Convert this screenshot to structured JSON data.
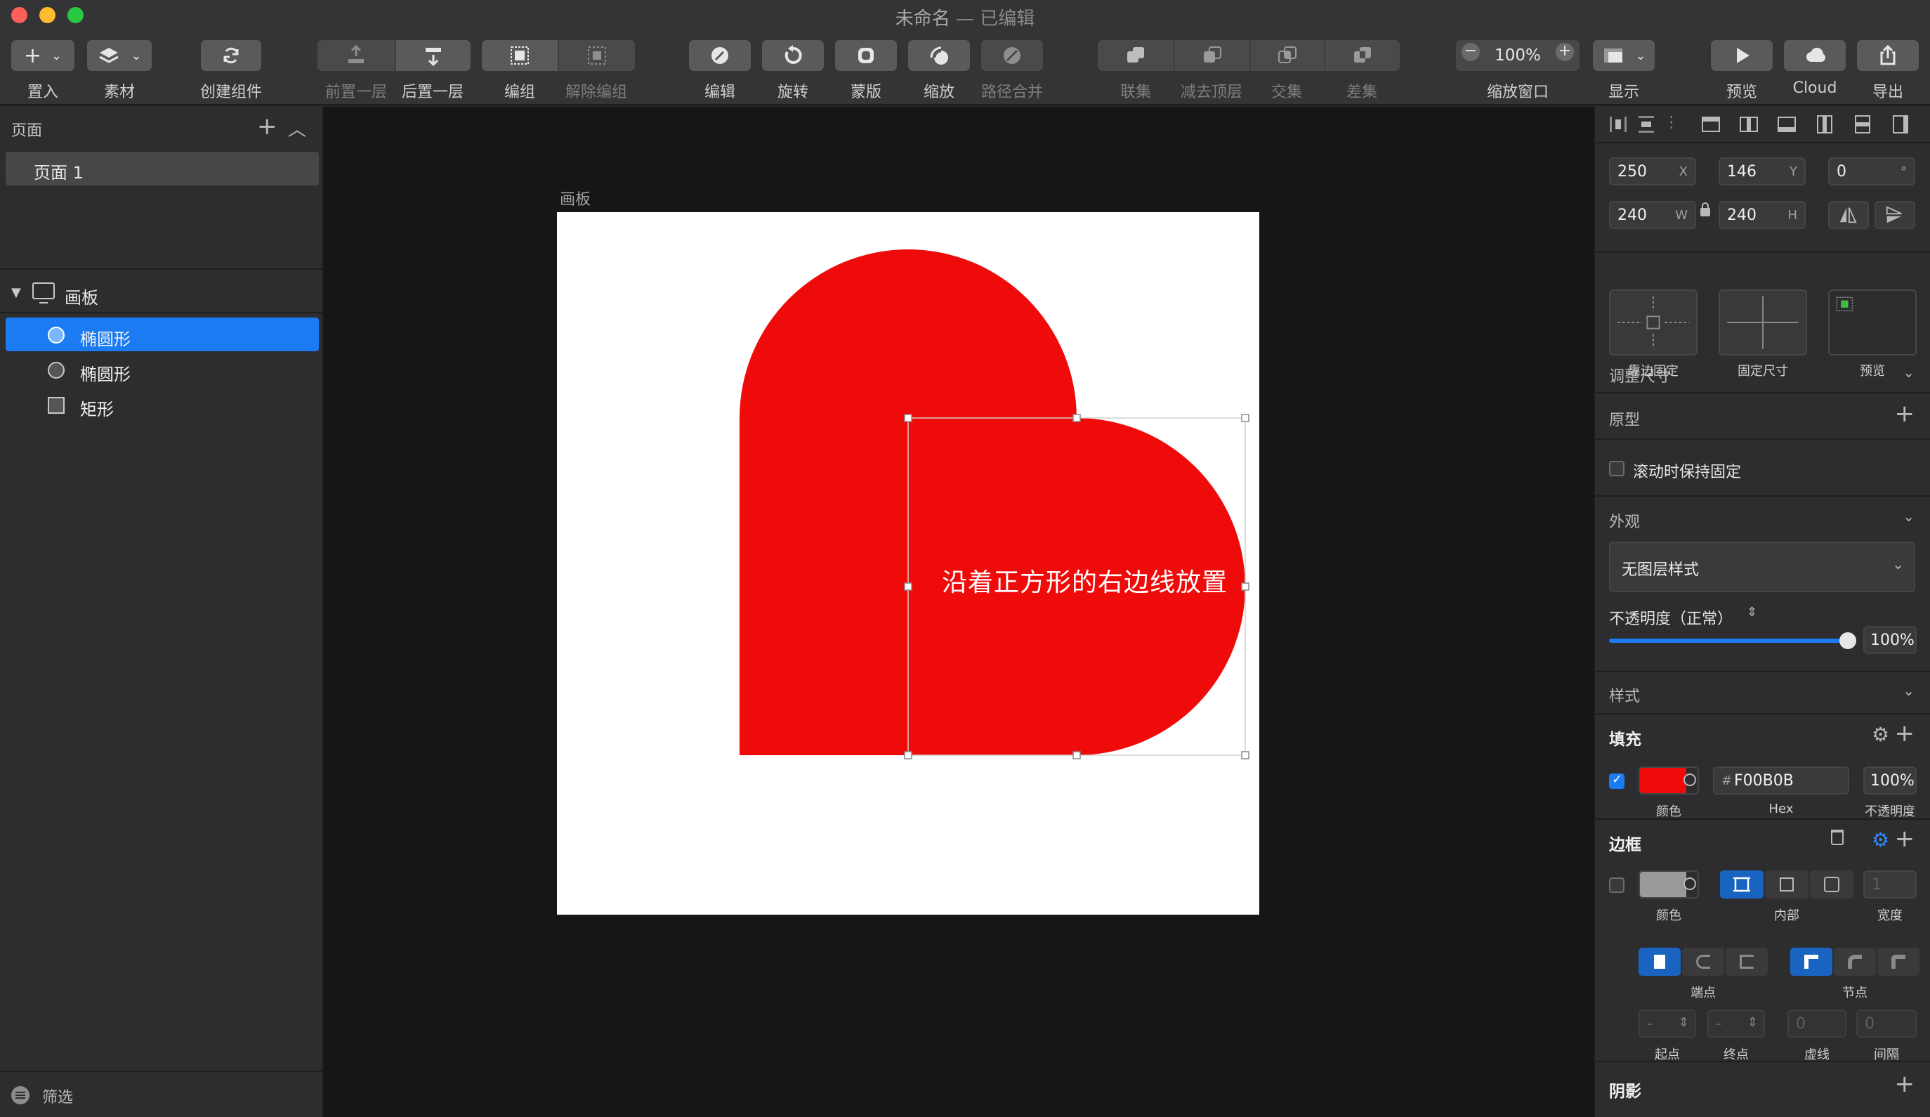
{
  "window": {
    "title": "未命名",
    "subtitle": "— 已编辑"
  },
  "toolbar": {
    "insert": "置入",
    "assets": "素材",
    "create_symbol": "创建组件",
    "forward": "前置一层",
    "backward": "后置一层",
    "group": "编组",
    "ungroup": "解除编组",
    "edit": "编辑",
    "rotate": "旋转",
    "mask": "蒙版",
    "scale": "缩放",
    "flatten": "路径合并",
    "union": "联集",
    "subtract": "减去顶层",
    "intersect": "交集",
    "difference": "差集",
    "zoom_value": "100%",
    "zoom_label": "缩放窗口",
    "view": "显示",
    "preview": "预览",
    "cloud": "Cloud",
    "export": "导出"
  },
  "left_panel": {
    "pages_title": "页面",
    "pages": [
      "页面 1"
    ],
    "artboard": "画板",
    "layers": [
      {
        "name": "椭圆形",
        "type": "oval",
        "selected": true
      },
      {
        "name": "椭圆形",
        "type": "oval",
        "selected": false
      },
      {
        "name": "矩形",
        "type": "rect",
        "selected": false
      }
    ],
    "filter": "筛选"
  },
  "canvas": {
    "artboard_label": "画板",
    "annotation": "沿着正方形的右边线放置",
    "shape_color": "#F00B0B"
  },
  "inspector": {
    "x": "250",
    "x_label": "X",
    "y": "146",
    "y_label": "Y",
    "rotation": "0",
    "rotation_unit": "°",
    "w": "240",
    "w_label": "W",
    "h": "240",
    "h_label": "H",
    "resizing_title": "调整尺寸",
    "resize_pin": "靠边固定",
    "resize_fix": "固定尺寸",
    "resize_preview": "预览",
    "prototype_title": "原型",
    "fix_on_scroll": "滚动时保持固定",
    "appearance_title": "外观",
    "layer_style": "无图层样式",
    "opacity_label": "不透明度（正常）",
    "opacity_value": "100%",
    "opacity_fraction": 1.0,
    "style_title": "样式",
    "fill_title": "填充",
    "fill_color": "#F00B0B",
    "fill_hex": "F00B0B",
    "fill_opacity": "100%",
    "color_label": "颜色",
    "hex_label": "Hex",
    "opacity_small": "不透明度",
    "border_title": "边框",
    "border_color": "#9a9a9a",
    "inside_label": "内部",
    "width_label": "宽度",
    "width_placeholder": "1",
    "ends_label": "端点",
    "joins_label": "节点",
    "start_label": "起点",
    "end_label": "终点",
    "dash_label": "虚线",
    "gap_label": "间隔",
    "dash_value": "0",
    "gap_value": "0",
    "start_value": "-",
    "end_value": "-",
    "shadow_title": "阴影"
  }
}
